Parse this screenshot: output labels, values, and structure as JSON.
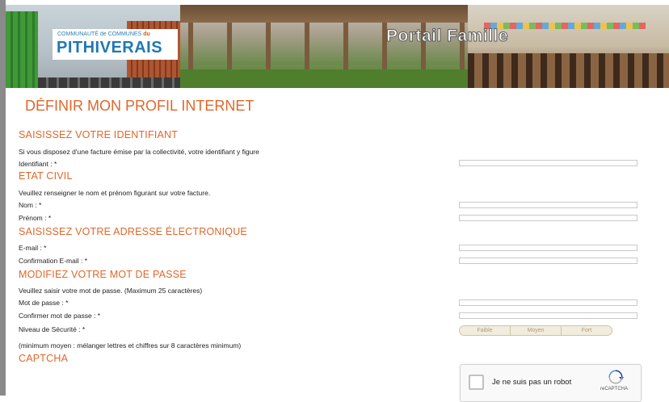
{
  "banner": {
    "logo_top": "COMMUNAUTÉ de COMMUNES",
    "logo_du": "du",
    "logo_name": "PITHIVERAIS",
    "portal_title": "Portail Famille"
  },
  "page": {
    "title": "DÉFINIR MON PROFIL INTERNET"
  },
  "sections": {
    "identifiant": {
      "heading": "SAISISSEZ VOTRE IDENTIFIANT",
      "info": "Si vous disposez d'une facture émise par la collectivité, votre identifiant y figure",
      "label": "Identifiant : *"
    },
    "etat_civil": {
      "heading": "ETAT CIVIL",
      "info": "Veuillez renseigner le nom et prénom figurant sur votre facture.",
      "nom_label": "Nom : *",
      "prenom_label": "Prénom : *"
    },
    "email": {
      "heading": "SAISISSEZ VOTRE ADRESSE ÉLECTRONIQUE",
      "email_label": "E-mail : *",
      "confirm_label": "Confirmation E-mail : *"
    },
    "password": {
      "heading": "MODIFIEZ VOTRE MOT DE PASSE",
      "info": "Veuillez saisir votre mot de passe. (Maximum 25 caractères)",
      "pwd_label": "Mot de passe : *",
      "confirm_label": "Confirmer mot de passe : *",
      "security_label": "Niveau de Sécurité : *",
      "strength_levels": [
        "Faible",
        "Moyen",
        "Fort"
      ],
      "hint": "(minimum moyen : mélanger lettres et chiffres sur 8 caractères minimum)"
    },
    "captcha": {
      "heading": "CAPTCHA",
      "checkbox_label": "Je ne suis pas un robot",
      "brand": "reCAPTCHA"
    }
  },
  "colors": {
    "accent": "#e0672a",
    "logo_blue": "#1f78b4"
  }
}
